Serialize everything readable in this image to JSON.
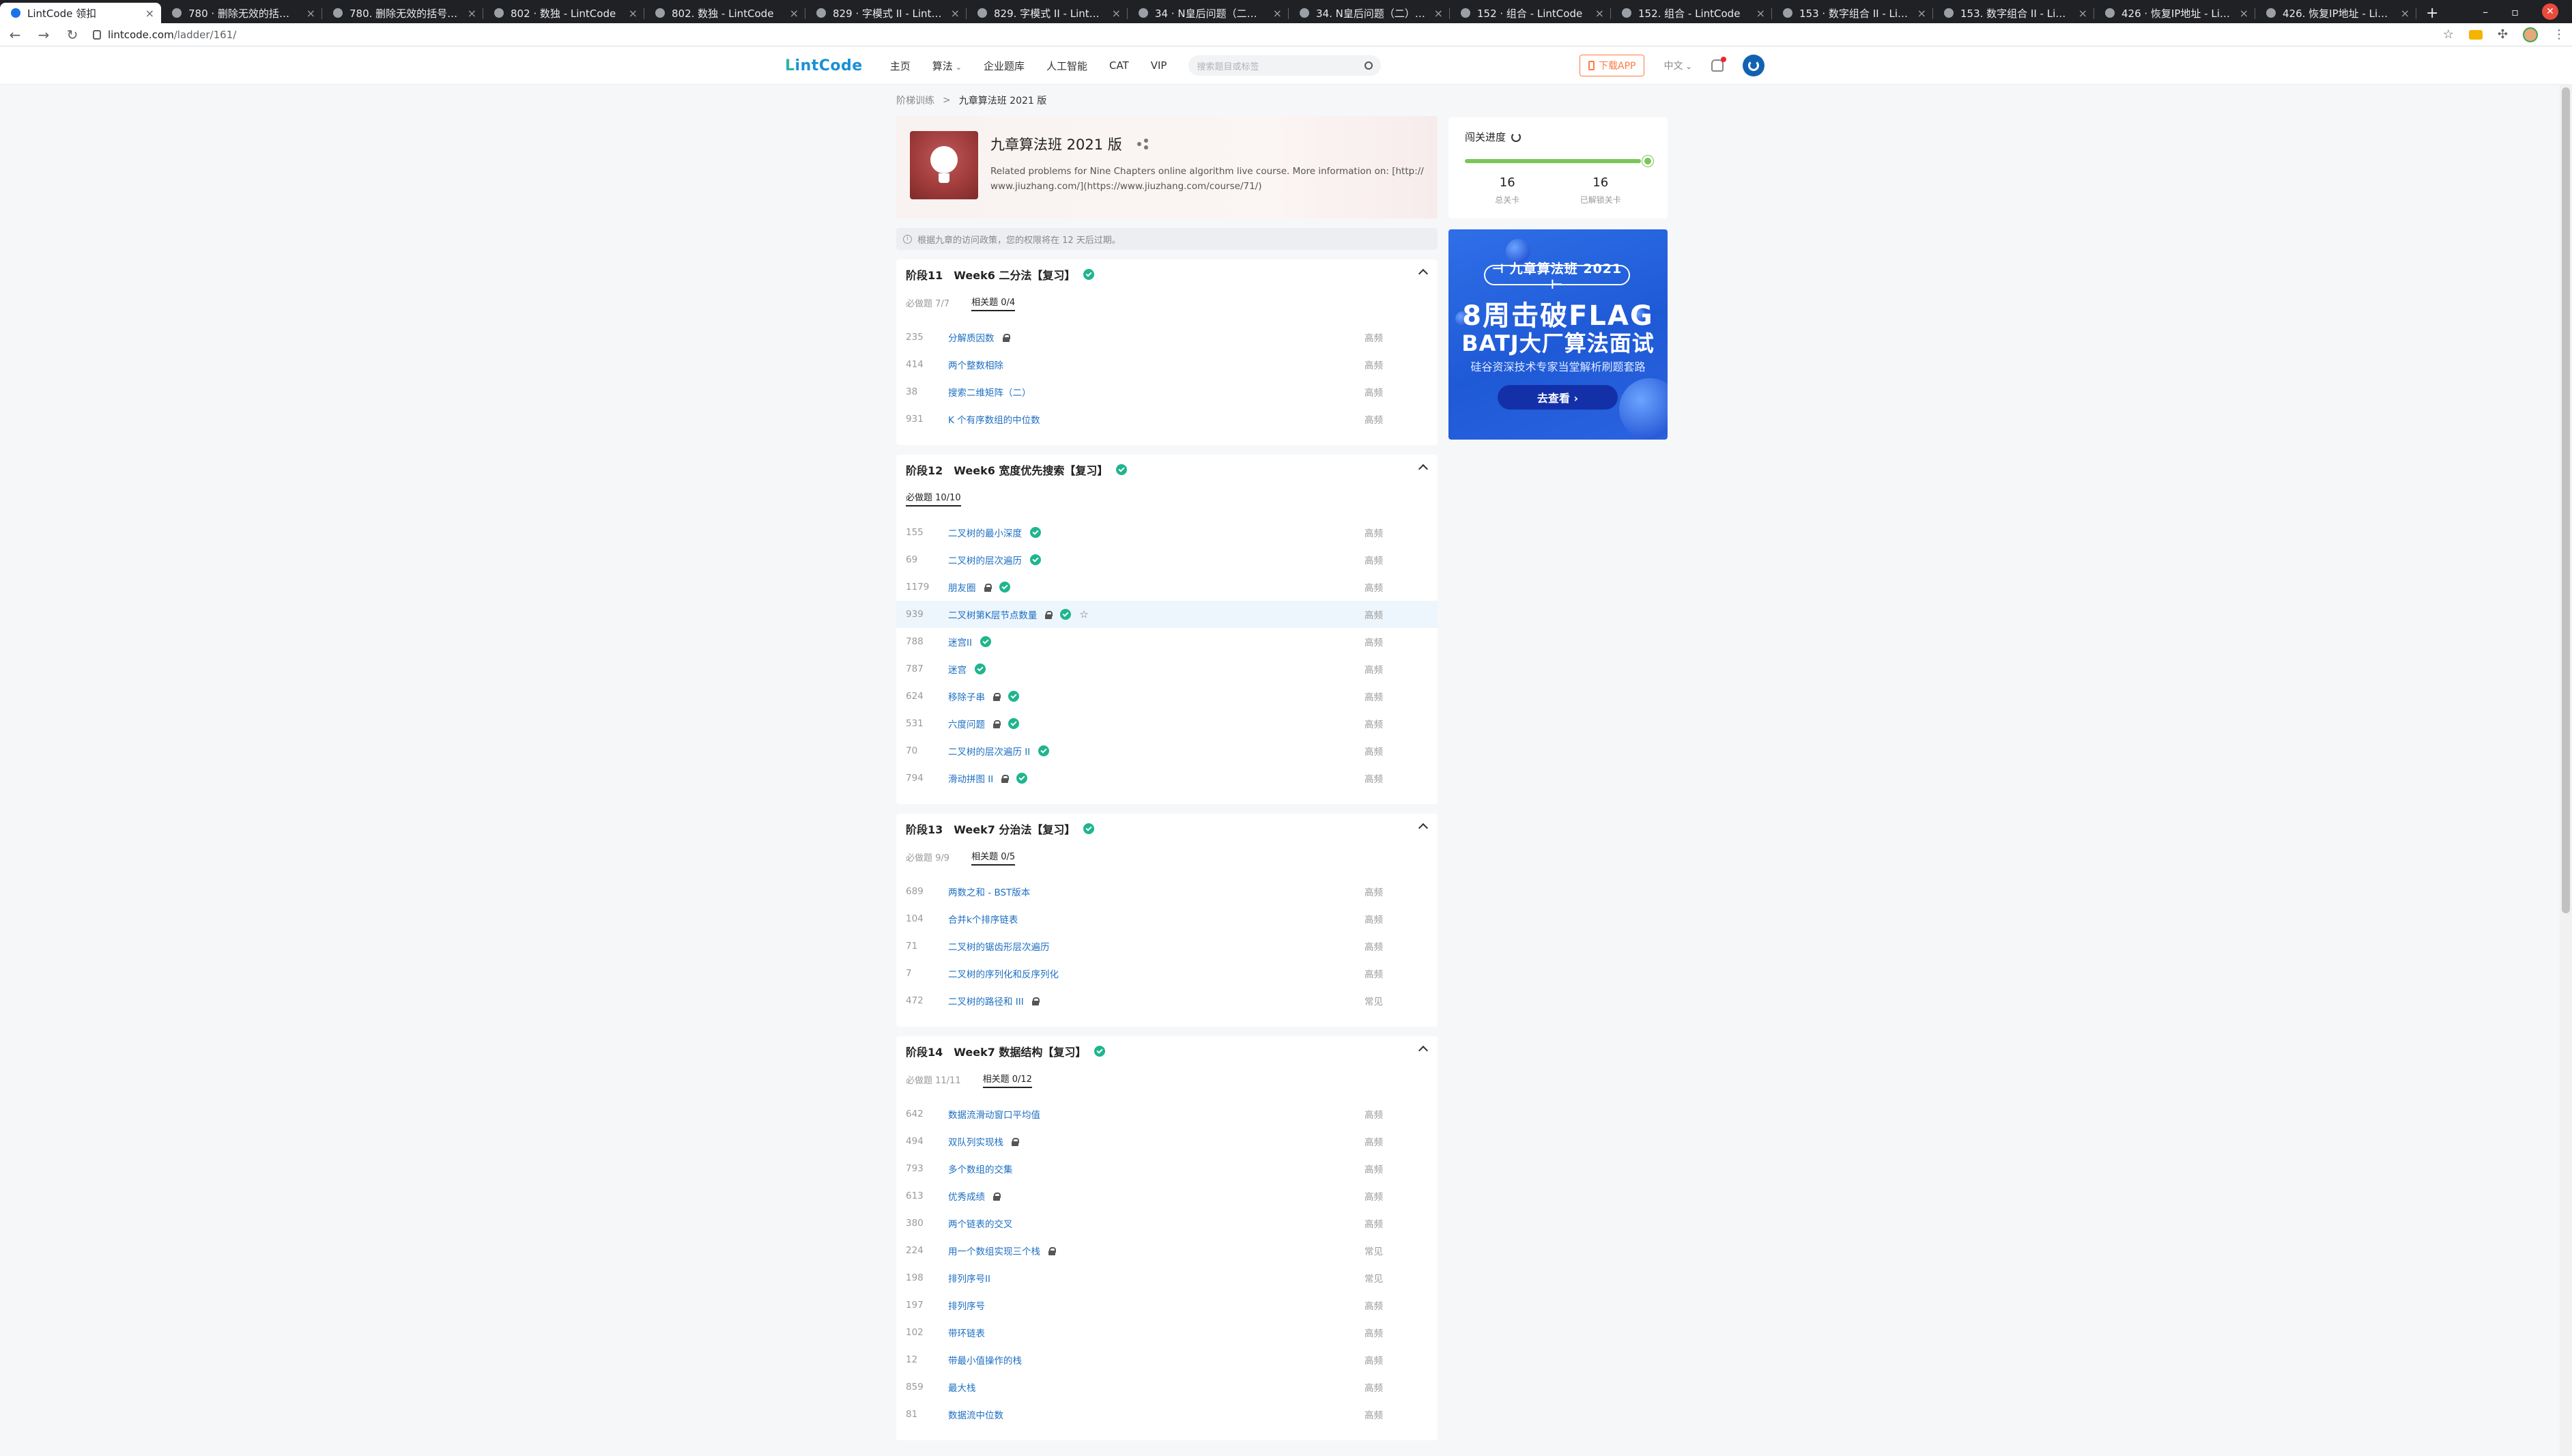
{
  "browser": {
    "tabs": [
      {
        "title": "LintCode 领扣",
        "active": true
      },
      {
        "title": "780 · 删除无效的括号 - LintCode"
      },
      {
        "title": "780. 删除无效的括号 - LintCode"
      },
      {
        "title": "802 · 数独 - LintCode"
      },
      {
        "title": "802. 数独 - LintCode"
      },
      {
        "title": "829 · 字模式 II - LintCode"
      },
      {
        "title": "829. 字模式 II - LintCode"
      },
      {
        "title": "34 · N皇后问题（二） - LintCode"
      },
      {
        "title": "34. N皇后问题（二） - LintCode"
      },
      {
        "title": "152 · 组合 - LintCode"
      },
      {
        "title": "152. 组合 - LintCode"
      },
      {
        "title": "153 · 数字组合 II - LintCode"
      },
      {
        "title": "153. 数字组合 II - LintCode"
      },
      {
        "title": "426 · 恢复IP地址 - LintCode"
      },
      {
        "title": "426. 恢复IP地址 - LintCode"
      }
    ],
    "url_host": "lintcode.com",
    "url_path": "/ladder/161/"
  },
  "header": {
    "logo_l": "L",
    "logo_rest": "intCode",
    "nav": [
      "主页",
      "算法",
      "企业题库",
      "人工智能",
      "CAT",
      "VIP"
    ],
    "search_placeholder": "搜索题目或标签",
    "download": "下载APP",
    "lang": "中文"
  },
  "breadcrumb": {
    "parent": "阶梯训练",
    "sep": ">",
    "current": "九章算法班 2021 版"
  },
  "course": {
    "title": "九章算法班 2021 版",
    "description": "Related problems for Nine Chapters online algorithm live course. More information on: [http://www.jiuzhang.com/](https://www.jiuzhang.com/course/71/)"
  },
  "notice": "根据九章的访问政策，您的权限将在 12 天后过期。",
  "stages": [
    {
      "label": "阶段11",
      "title": "Week6 二分法【复习】",
      "tabs": [
        {
          "label": "必做题 7/7",
          "active": false
        },
        {
          "label": "相关题 0/4",
          "active": true
        }
      ],
      "problems": [
        {
          "id": "235",
          "name": "分解质因数",
          "lock": true,
          "done": false,
          "freq": "高频"
        },
        {
          "id": "414",
          "name": "两个整数相除",
          "lock": false,
          "done": false,
          "freq": "高频"
        },
        {
          "id": "38",
          "name": "搜索二维矩阵（二）",
          "lock": false,
          "done": false,
          "freq": "高频"
        },
        {
          "id": "931",
          "name": "K 个有序数组的中位数",
          "lock": false,
          "done": false,
          "freq": "高频"
        }
      ]
    },
    {
      "label": "阶段12",
      "title": "Week6 宽度优先搜索【复习】",
      "tabs": [
        {
          "label": "必做题 10/10",
          "active": true
        }
      ],
      "problems": [
        {
          "id": "155",
          "name": "二叉树的最小深度",
          "lock": false,
          "done": true,
          "freq": "高频"
        },
        {
          "id": "69",
          "name": "二叉树的层次遍历",
          "lock": false,
          "done": true,
          "freq": "高频"
        },
        {
          "id": "1179",
          "name": "朋友圈",
          "lock": true,
          "done": true,
          "freq": "高频"
        },
        {
          "id": "939",
          "name": "二叉树第K层节点数量",
          "lock": true,
          "done": true,
          "star": true,
          "highlight": true,
          "freq": "高频"
        },
        {
          "id": "788",
          "name": "迷宫II",
          "lock": false,
          "done": true,
          "freq": "高频"
        },
        {
          "id": "787",
          "name": "迷宫",
          "lock": false,
          "done": true,
          "freq": "高频"
        },
        {
          "id": "624",
          "name": "移除子串",
          "lock": true,
          "done": true,
          "freq": "高频"
        },
        {
          "id": "531",
          "name": "六度问题",
          "lock": true,
          "done": true,
          "freq": "高频"
        },
        {
          "id": "70",
          "name": "二叉树的层次遍历 II",
          "lock": false,
          "done": true,
          "freq": "高频"
        },
        {
          "id": "794",
          "name": "滑动拼图 II",
          "lock": true,
          "done": true,
          "freq": "高频"
        }
      ]
    },
    {
      "label": "阶段13",
      "title": "Week7 分治法【复习】",
      "tabs": [
        {
          "label": "必做题 9/9",
          "active": false
        },
        {
          "label": "相关题 0/5",
          "active": true
        }
      ],
      "problems": [
        {
          "id": "689",
          "name": "两数之和 - BST版本",
          "lock": false,
          "done": false,
          "freq": "高频"
        },
        {
          "id": "104",
          "name": "合并k个排序链表",
          "lock": false,
          "done": false,
          "freq": "高频"
        },
        {
          "id": "71",
          "name": "二叉树的锯齿形层次遍历",
          "lock": false,
          "done": false,
          "freq": "高频"
        },
        {
          "id": "7",
          "name": "二叉树的序列化和反序列化",
          "lock": false,
          "done": false,
          "freq": "高频"
        },
        {
          "id": "472",
          "name": "二叉树的路径和 III",
          "lock": true,
          "done": false,
          "freq": "常见"
        }
      ]
    },
    {
      "label": "阶段14",
      "title": "Week7 数据结构【复习】",
      "tabs": [
        {
          "label": "必做题 11/11",
          "active": false
        },
        {
          "label": "相关题 0/12",
          "active": true
        }
      ],
      "problems": [
        {
          "id": "642",
          "name": "数据流滑动窗口平均值",
          "lock": false,
          "done": false,
          "freq": "高频"
        },
        {
          "id": "494",
          "name": "双队列实现栈",
          "lock": true,
          "done": false,
          "freq": "高频"
        },
        {
          "id": "793",
          "name": "多个数组的交集",
          "lock": false,
          "done": false,
          "freq": "高频"
        },
        {
          "id": "613",
          "name": "优秀成绩",
          "lock": true,
          "done": false,
          "freq": "高频"
        },
        {
          "id": "380",
          "name": "两个链表的交叉",
          "lock": false,
          "done": false,
          "freq": "高频"
        },
        {
          "id": "224",
          "name": "用一个数组实现三个栈",
          "lock": true,
          "done": false,
          "freq": "常见"
        },
        {
          "id": "198",
          "name": "排列序号II",
          "lock": false,
          "done": false,
          "freq": "常见"
        },
        {
          "id": "197",
          "name": "排列序号",
          "lock": false,
          "done": false,
          "freq": "高频"
        },
        {
          "id": "102",
          "name": "带环链表",
          "lock": false,
          "done": false,
          "freq": "高频"
        },
        {
          "id": "12",
          "name": "带最小值操作的栈",
          "lock": false,
          "done": false,
          "freq": "高频"
        },
        {
          "id": "859",
          "name": "最大栈",
          "lock": false,
          "done": false,
          "freq": "高频"
        },
        {
          "id": "81",
          "name": "数据流中位数",
          "lock": false,
          "done": false,
          "freq": "高频"
        }
      ]
    }
  ],
  "progress": {
    "title": "闯关进度",
    "fraction": 1.0,
    "total": "16",
    "total_label": "总关卡",
    "unlocked": "16",
    "unlocked_label": "已解锁关卡",
    "color": "#7bc657"
  },
  "promo": {
    "pill": "⊣ 九章算法班 2021 ⊢",
    "headline1": "8周击破FLAG",
    "headline2": "BATJ大厂算法面试",
    "subline": "硅谷资深技术专家当堂解析刷题套路",
    "button": "去查看 ›"
  },
  "colors": {
    "accent": "#1d6fc2",
    "done": "#1fb58e",
    "download": "#ff7a45"
  }
}
